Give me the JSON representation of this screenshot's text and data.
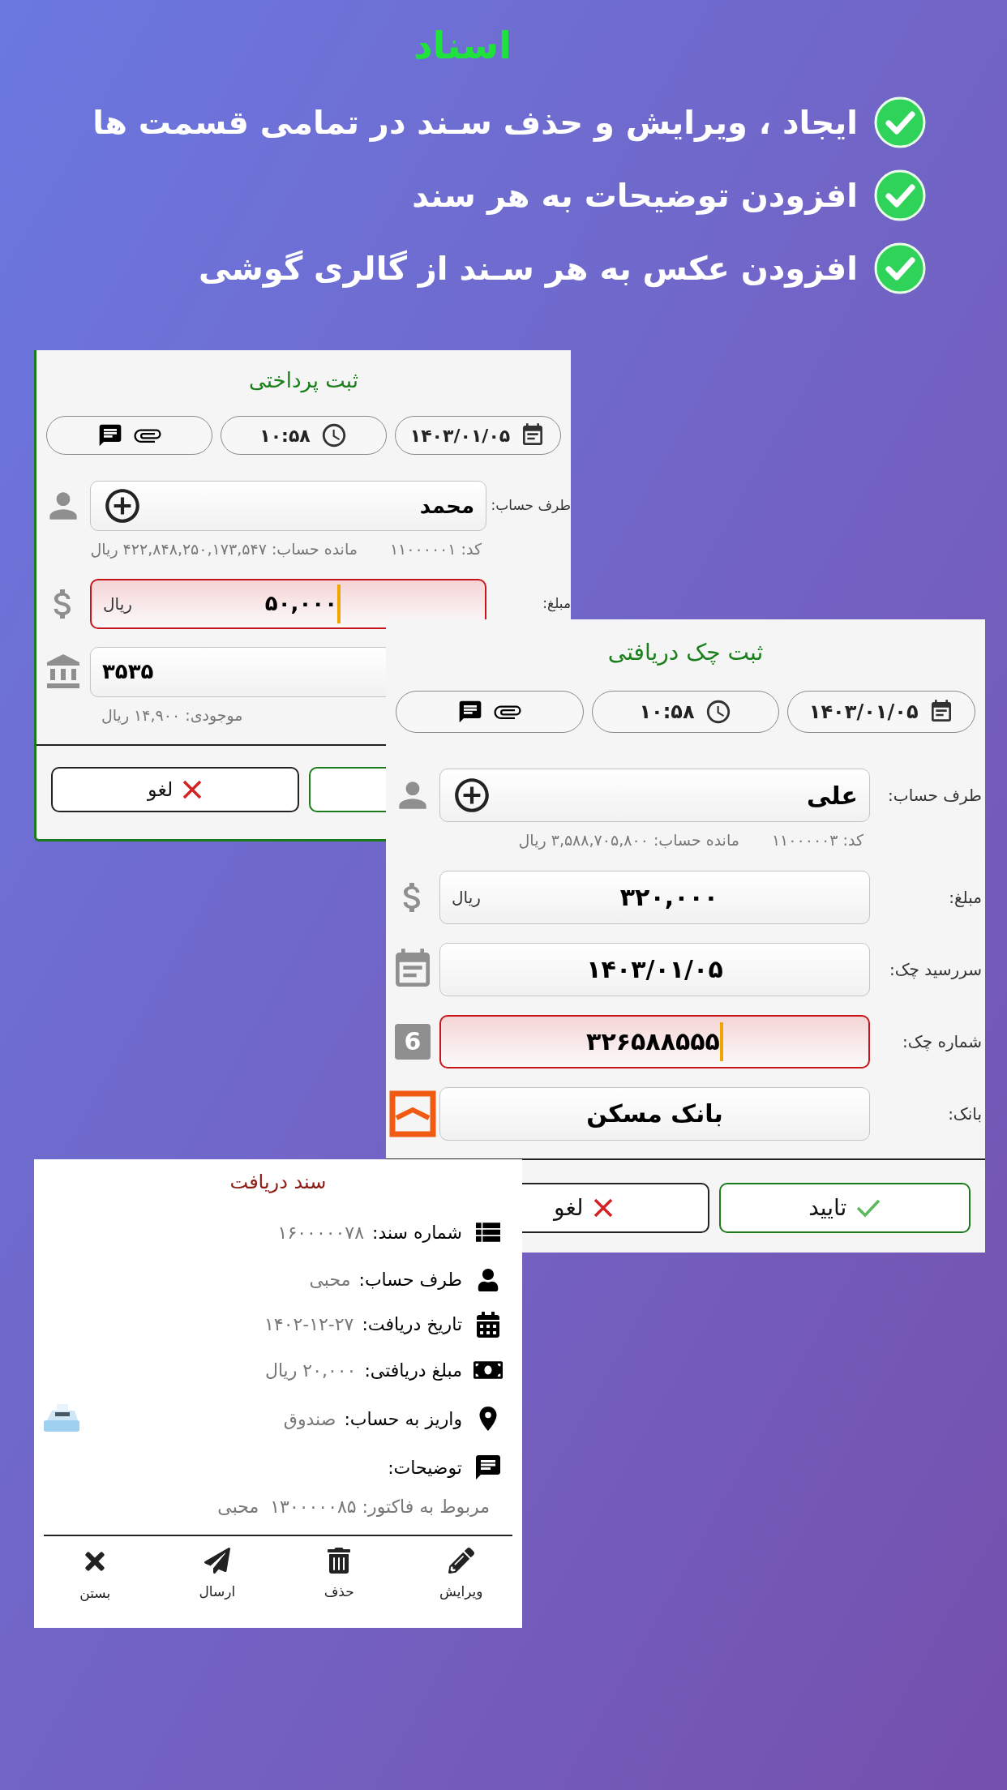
{
  "header": {
    "title": "اسناد",
    "features": [
      {
        "text": "ایجاد ، ویرایش و حذف سـند در تمامی قسمت ها",
        "checked": true
      },
      {
        "text": "افزودن توضیحات به هر سند",
        "checked": true
      },
      {
        "text": "افزودن عکس به هر سـند از گالری گوشی",
        "checked": true
      }
    ]
  },
  "payment_form": {
    "title": "ثبت پرداختی",
    "date": "۱۴۰۳/۰۱/۰۵",
    "time": "۱۰:۵۸",
    "fields": [
      {
        "kind": "account",
        "label": "طرف حساب:",
        "value": "محمد",
        "code": "کد: ۱۱۰۰۰۰۰۱",
        "balance": "مانده حساب: ۴۲۲,۸۴۸,۲۵۰,۱۷۳,۵۴۷ ریال",
        "error": false,
        "focused": false
      },
      {
        "kind": "amount",
        "label": "مبلغ:",
        "value": "۵۰,۰۰۰",
        "unit": "ریال",
        "error": true,
        "focused": true
      },
      {
        "kind": "cash_bank",
        "value": "۳۵۳۵",
        "balance": "موجودی: ۱۴,۹۰۰ ریال",
        "error": false,
        "focused": false
      }
    ],
    "buttons": [
      {
        "kind": "confirm"
      },
      {
        "kind": "cancel",
        "label": "لغو"
      }
    ]
  },
  "check_form": {
    "title": "ثبت چک دریافتی",
    "date": "۱۴۰۳/۰۱/۰۵",
    "time": "۱۰:۵۸",
    "fields": [
      {
        "kind": "account",
        "label": "طرف حساب:",
        "value": "علی",
        "code": "کد: ۱۱۰۰۰۰۰۳",
        "balance": "مانده حساب: ۳,۵۸۸,۷۰۵,۸۰۰ ریال",
        "error": false,
        "focused": false
      },
      {
        "kind": "amount",
        "label": "مبلغ:",
        "value": "۳۲۰,۰۰۰",
        "unit": "ریال",
        "error": false,
        "focused": false
      },
      {
        "kind": "due_date",
        "label": "سررسید چک:",
        "value": "۱۴۰۳/۰۱/۰۵",
        "error": false,
        "focused": false
      },
      {
        "kind": "check_number",
        "label": "شماره چک:",
        "badge": "6",
        "value": "۳۲۶۵۸۸۵۵۵",
        "error": true,
        "focused": true
      },
      {
        "kind": "bank",
        "label": "بانک:",
        "value": "بانک مسکن",
        "error": false,
        "focused": false
      }
    ],
    "buttons": [
      {
        "kind": "confirm",
        "label": "تایید"
      },
      {
        "kind": "cancel",
        "label": "لغو"
      }
    ]
  },
  "receipt": {
    "title": "سند دریافت",
    "rows": [
      {
        "kind": "number",
        "label": "شماره سند:",
        "value": "۱۶۰۰۰۰۰۷۸"
      },
      {
        "kind": "party",
        "label": "طرف حساب:",
        "value": "محبی"
      },
      {
        "kind": "date",
        "label": "تاریخ دریافت:",
        "value": "۱۴۰۲-۱۲-۲۷"
      },
      {
        "kind": "amount",
        "label": "مبلغ دریافتی:",
        "value": "۲۰,۰۰۰ ریال"
      },
      {
        "kind": "deposit",
        "label": "واریز به حساب:",
        "value": "صندوق"
      },
      {
        "kind": "note",
        "label": "توضیحات:",
        "value": "مربوط به فاکتور: ۱۳۰۰۰۰۰۸۵  محبی"
      }
    ],
    "actions": [
      {
        "kind": "edit",
        "label": "ویرایش"
      },
      {
        "kind": "delete",
        "label": "حذف"
      },
      {
        "kind": "send",
        "label": "ارسال"
      },
      {
        "kind": "close",
        "label": "بستن"
      }
    ]
  }
}
